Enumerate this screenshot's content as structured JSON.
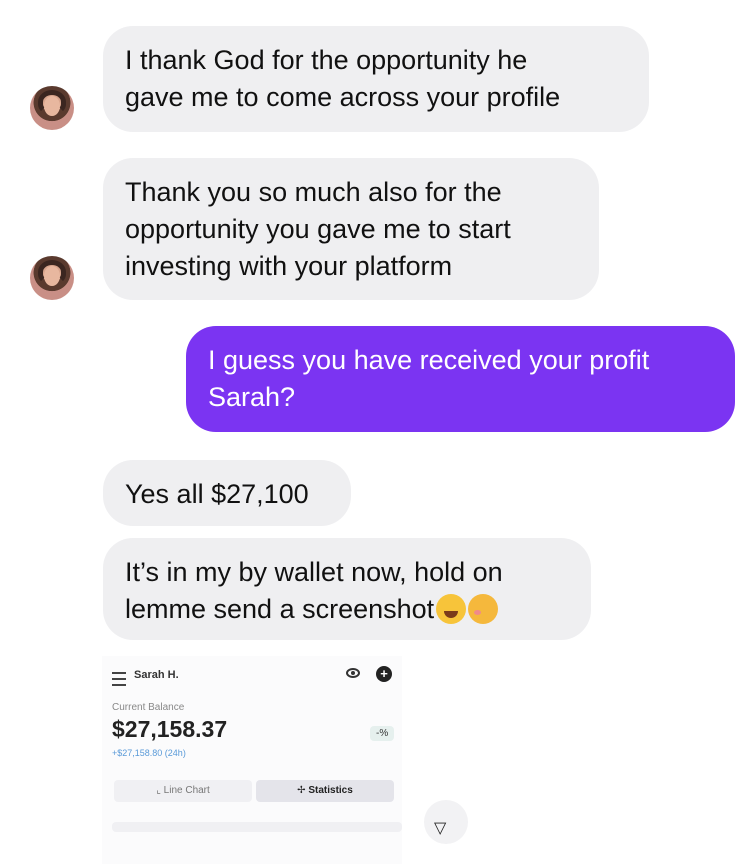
{
  "messages": [
    {
      "direction": "incoming",
      "lines": [
        "I thank God for the opportunity he",
        "gave me to come across your profile"
      ]
    },
    {
      "direction": "incoming",
      "lines": [
        "Thank you so much also for the",
        "opportunity you gave me to start",
        "investing with your platform"
      ]
    },
    {
      "direction": "outgoing",
      "lines": [
        "I guess you have received your profit",
        "Sarah?"
      ]
    },
    {
      "direction": "incoming",
      "lines": [
        "Yes all $27,100"
      ]
    },
    {
      "direction": "incoming",
      "lines": [
        "It’s in my by wallet now, hold on",
        "lemme send a screenshot"
      ],
      "emojis": [
        "star-struck-emoji",
        "smiling-face-with-hearts-emoji"
      ]
    }
  ],
  "wallet": {
    "user": "Sarah H.",
    "balance_label": "Current Balance",
    "balance": "$27,158.37",
    "change": "+$27,158.80 (24h)",
    "percent": "-%",
    "tabs": [
      "Line Chart",
      "Statistics"
    ]
  },
  "colors": {
    "outgoing_bubble": "#7b34f2",
    "incoming_bubble": "#efeff1"
  }
}
